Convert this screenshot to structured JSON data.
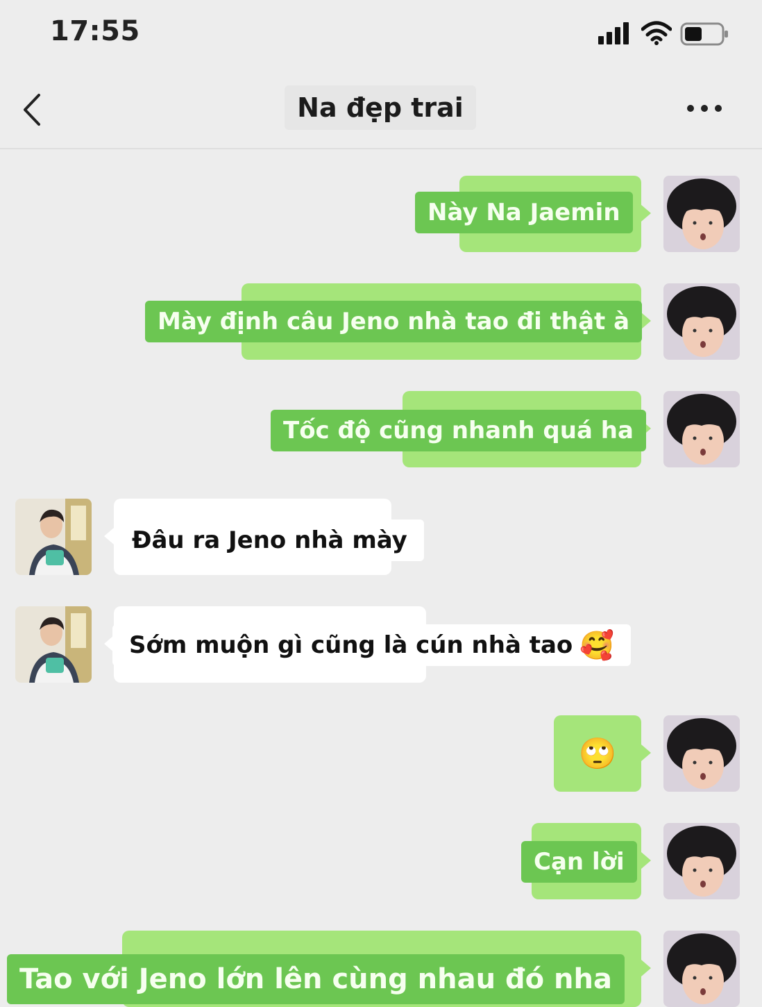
{
  "status_bar": {
    "time": "17:55"
  },
  "header": {
    "title": "Na đẹp trai"
  },
  "messages": [
    {
      "side": "right",
      "text": "Này Na Jaemin"
    },
    {
      "side": "right",
      "text": "Mày định câu Jeno nhà tao đi thật à"
    },
    {
      "side": "right",
      "text": "Tốc độ cũng nhanh quá ha"
    },
    {
      "side": "left",
      "text": "Đâu ra Jeno nhà mày"
    },
    {
      "side": "left",
      "text": "Sớm muộn gì cũng là cún nhà tao",
      "emoji": "🥰"
    },
    {
      "side": "right",
      "emoji": "🙄"
    },
    {
      "side": "right",
      "text": "Cạn lời"
    },
    {
      "side": "right",
      "text": "Tao với Jeno lớn lên cùng nhau đó nha"
    }
  ]
}
